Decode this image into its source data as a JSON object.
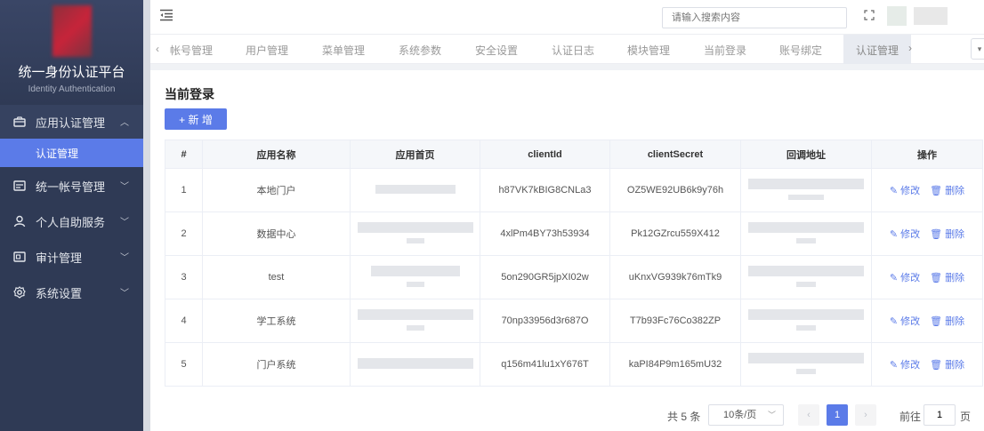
{
  "sidebar": {
    "logo_title": "统一身份认证平台",
    "logo_subtitle": "Identity Authentication",
    "menu": [
      {
        "label": "应用认证管理",
        "icon": "app-box-icon",
        "open": true
      },
      {
        "label": "统一帐号管理",
        "icon": "id-card-icon"
      },
      {
        "label": "个人自助服务",
        "icon": "user-icon"
      },
      {
        "label": "审计管理",
        "icon": "audit-icon"
      },
      {
        "label": "系统设置",
        "icon": "gear-icon"
      }
    ],
    "submenu_active": "认证管理"
  },
  "header": {
    "search_placeholder": "请输入搜索内容"
  },
  "tabs": [
    "帐号管理",
    "用户管理",
    "菜单管理",
    "系统参数",
    "安全设置",
    "认证日志",
    "模块管理",
    "当前登录",
    "账号绑定",
    "认证管理"
  ],
  "active_tab": "认证管理",
  "page": {
    "title": "当前登录",
    "add_button": "+ 新 增"
  },
  "table": {
    "headers": [
      "#",
      "应用名称",
      "应用首页",
      "clientId",
      "clientSecret",
      "回调地址",
      "操作"
    ],
    "rows": [
      {
        "num": "1",
        "name": "本地门户",
        "clientId": "h87VK7kBIG8CNLa3",
        "clientSecret": "OZ5WE92UB6k9y76h"
      },
      {
        "num": "2",
        "name": "数据中心",
        "clientId": "4xlPm4BY73h53934",
        "clientSecret": "Pk12GZrcu559X412"
      },
      {
        "num": "3",
        "name": "test",
        "clientId": "5on290GR5jpXI02w",
        "clientSecret": "uKnxVG939k76mTk9"
      },
      {
        "num": "4",
        "name": "学工系统",
        "clientId": "70np33956d3r687O",
        "clientSecret": "T7b93Fc76Co382ZP"
      },
      {
        "num": "5",
        "name": "门户系统",
        "clientId": "q156m41lu1xY676T",
        "clientSecret": "kaPI84P9m165mU32"
      }
    ],
    "edit_label": "修改",
    "delete_label": "删除"
  },
  "pagination": {
    "total": "共 5 条",
    "page_size": "10条/页",
    "current": "1",
    "goto_prefix": "前往",
    "goto_value": "1",
    "goto_suffix": "页"
  }
}
